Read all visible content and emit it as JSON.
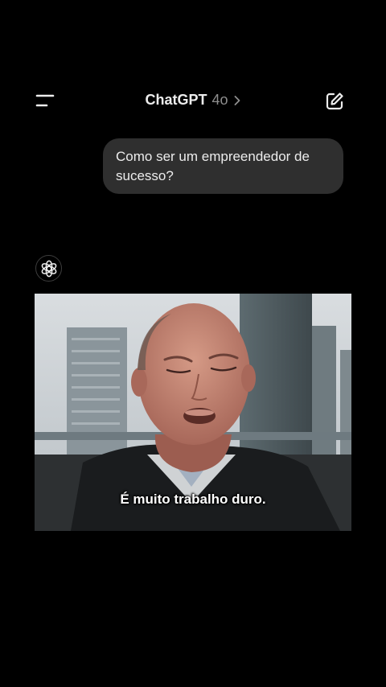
{
  "header": {
    "title": "ChatGPT",
    "model": "4o",
    "menu_icon": "menu-icon",
    "edit_icon": "new-chat-icon"
  },
  "conversation": {
    "user_message": "Como ser um empreendedor de sucesso?",
    "assistant_icon": "openai-logo-icon",
    "video": {
      "caption": "É muito trabalho duro."
    }
  },
  "colors": {
    "background": "#000000",
    "bubble": "#2f2f2f",
    "text": "#ececec",
    "muted": "#8e8e8e"
  }
}
